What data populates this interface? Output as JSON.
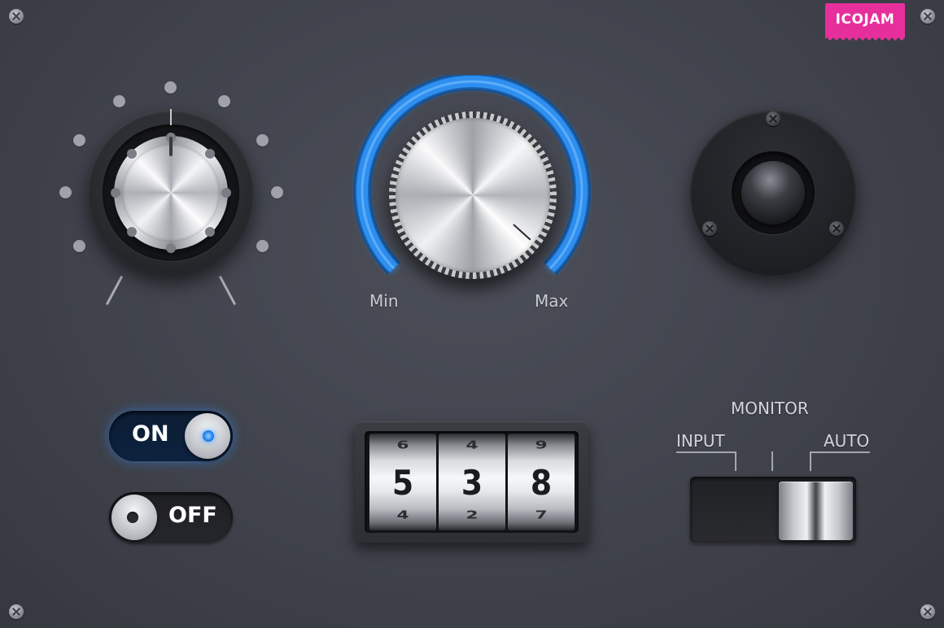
{
  "brand": {
    "logo": "ICOJAM",
    "logo_color": "#e72f9c"
  },
  "volume_knob": {
    "scale_label_min": "Min",
    "scale_label_max": "Max",
    "accent_color": "#2f8ff0"
  },
  "toggles": {
    "on": {
      "label": "ON",
      "state": "on",
      "led_color": "#1e7ff0"
    },
    "off": {
      "label": "OFF",
      "state": "off"
    }
  },
  "counter": {
    "drums": [
      {
        "above": "6",
        "value": "5",
        "below": "4"
      },
      {
        "above": "4",
        "value": "3",
        "below": "2"
      },
      {
        "above": "9",
        "value": "8",
        "below": "7"
      }
    ]
  },
  "monitor": {
    "title": "MONITOR",
    "option_left": "INPUT",
    "option_right": "AUTO",
    "selected": "AUTO"
  },
  "icons": {
    "screw": "screw-icon",
    "speaker": "speaker-icon"
  }
}
